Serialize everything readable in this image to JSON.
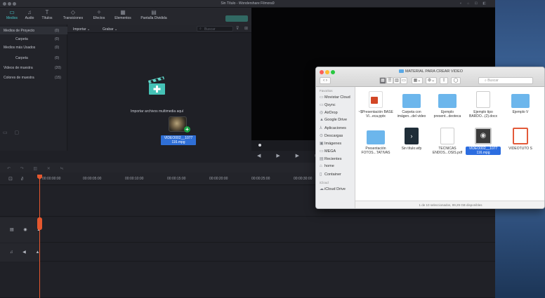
{
  "app": {
    "title": "Sin Título - Wondershare Filmora9"
  },
  "tabs": [
    {
      "label": "Medios",
      "icon": "folder-icon",
      "active": true
    },
    {
      "label": "Audio",
      "icon": "music-note-icon",
      "active": false
    },
    {
      "label": "Títulos",
      "icon": "text-icon",
      "active": false
    },
    {
      "label": "Transiciones",
      "icon": "transition-icon",
      "active": false
    },
    {
      "label": "Efectos",
      "icon": "effects-icon",
      "active": false
    },
    {
      "label": "Elementos",
      "icon": "elements-icon",
      "active": false
    },
    {
      "label": "Pantalla Dividida",
      "icon": "split-screen-icon",
      "active": false
    }
  ],
  "sidebar": {
    "items": [
      {
        "label": "Medios de Proyecto",
        "count": "(0)",
        "indent": false,
        "selected": true
      },
      {
        "label": "Carpeta",
        "count": "(0)",
        "indent": true,
        "selected": false
      },
      {
        "label": "Medios más Usados",
        "count": "(0)",
        "indent": false,
        "selected": false
      },
      {
        "label": "Carpeta",
        "count": "(0)",
        "indent": true,
        "selected": false
      },
      {
        "label": "Videos de muestra",
        "count": "(20)",
        "indent": false,
        "selected": false
      },
      {
        "label": "Colores de muestra",
        "count": "(15)",
        "indent": false,
        "selected": false
      }
    ]
  },
  "media": {
    "import_label": "Importar",
    "record_label": "Grabar",
    "search_placeholder": "Buscar",
    "import_hint": "Importar archivos multimedia aquí",
    "dragged_file": "VIDEO002__1077 116.mpg"
  },
  "timeline": {
    "ticks": [
      "00:00:00:00",
      "00:00:05:00",
      "00:00:10:00",
      "00:00:15:00",
      "00:00:20:00",
      "00:00:25:00",
      "00:00:30:00"
    ]
  },
  "finder": {
    "title": "MATERIAL PARA CREAR VIDEO",
    "search_placeholder": "Buscar",
    "sections": {
      "favorites": "Favoritos",
      "icloud": "iCloud"
    },
    "favorites": [
      {
        "label": "Movistar Cloud",
        "icon": "folder-icon"
      },
      {
        "label": "Qsync",
        "icon": "folder-icon"
      },
      {
        "label": "AirDrop",
        "icon": "airdrop-icon"
      },
      {
        "label": "Google Drive",
        "icon": "google-drive-icon"
      },
      {
        "label": "Aplicaciones",
        "icon": "applications-icon"
      },
      {
        "label": "Descargas",
        "icon": "downloads-icon"
      },
      {
        "label": "Imágenes",
        "icon": "pictures-icon"
      },
      {
        "label": "MEGA",
        "icon": "folder-icon"
      },
      {
        "label": "Recientes",
        "icon": "recents-icon"
      },
      {
        "label": "home",
        "icon": "home-icon"
      },
      {
        "label": "Container",
        "icon": "document-icon"
      }
    ],
    "icloud_items": [
      {
        "label": "iCloud Drive",
        "icon": "cloud-icon"
      }
    ],
    "files": [
      {
        "label": "~$Presentación BASE VI...eca.pptx",
        "kind": "pptx",
        "selected": false
      },
      {
        "label": "Carpeta con imágen...del video",
        "kind": "folder",
        "selected": false
      },
      {
        "label": "Ejemplo present...deoteca",
        "kind": "folder",
        "selected": false
      },
      {
        "label": "Ejemplo tipo BARDO...(2).docx",
        "kind": "docx",
        "selected": false
      },
      {
        "label": "Ejemplo V",
        "kind": "folder",
        "selected": false
      },
      {
        "label": "Presentación FOTOS...TATIVAS",
        "kind": "folder",
        "selected": false
      },
      {
        "label": "Sin título.wfp",
        "kind": "wfp",
        "selected": false
      },
      {
        "label": "TECNICAS ENDOS...OSIS.pdf",
        "kind": "pdf",
        "selected": false
      },
      {
        "label": "VIDEO002__1077 116.mpg",
        "kind": "video",
        "selected": true
      },
      {
        "label": "VIDEOTUTO S",
        "kind": "video-alt",
        "selected": false
      }
    ],
    "status": "1 de 10 seleccionados, 99,29 GB disponibles"
  },
  "colors": {
    "accent": "#48c6c9",
    "selection": "#2c6de0",
    "playhead": "#e4572e"
  }
}
